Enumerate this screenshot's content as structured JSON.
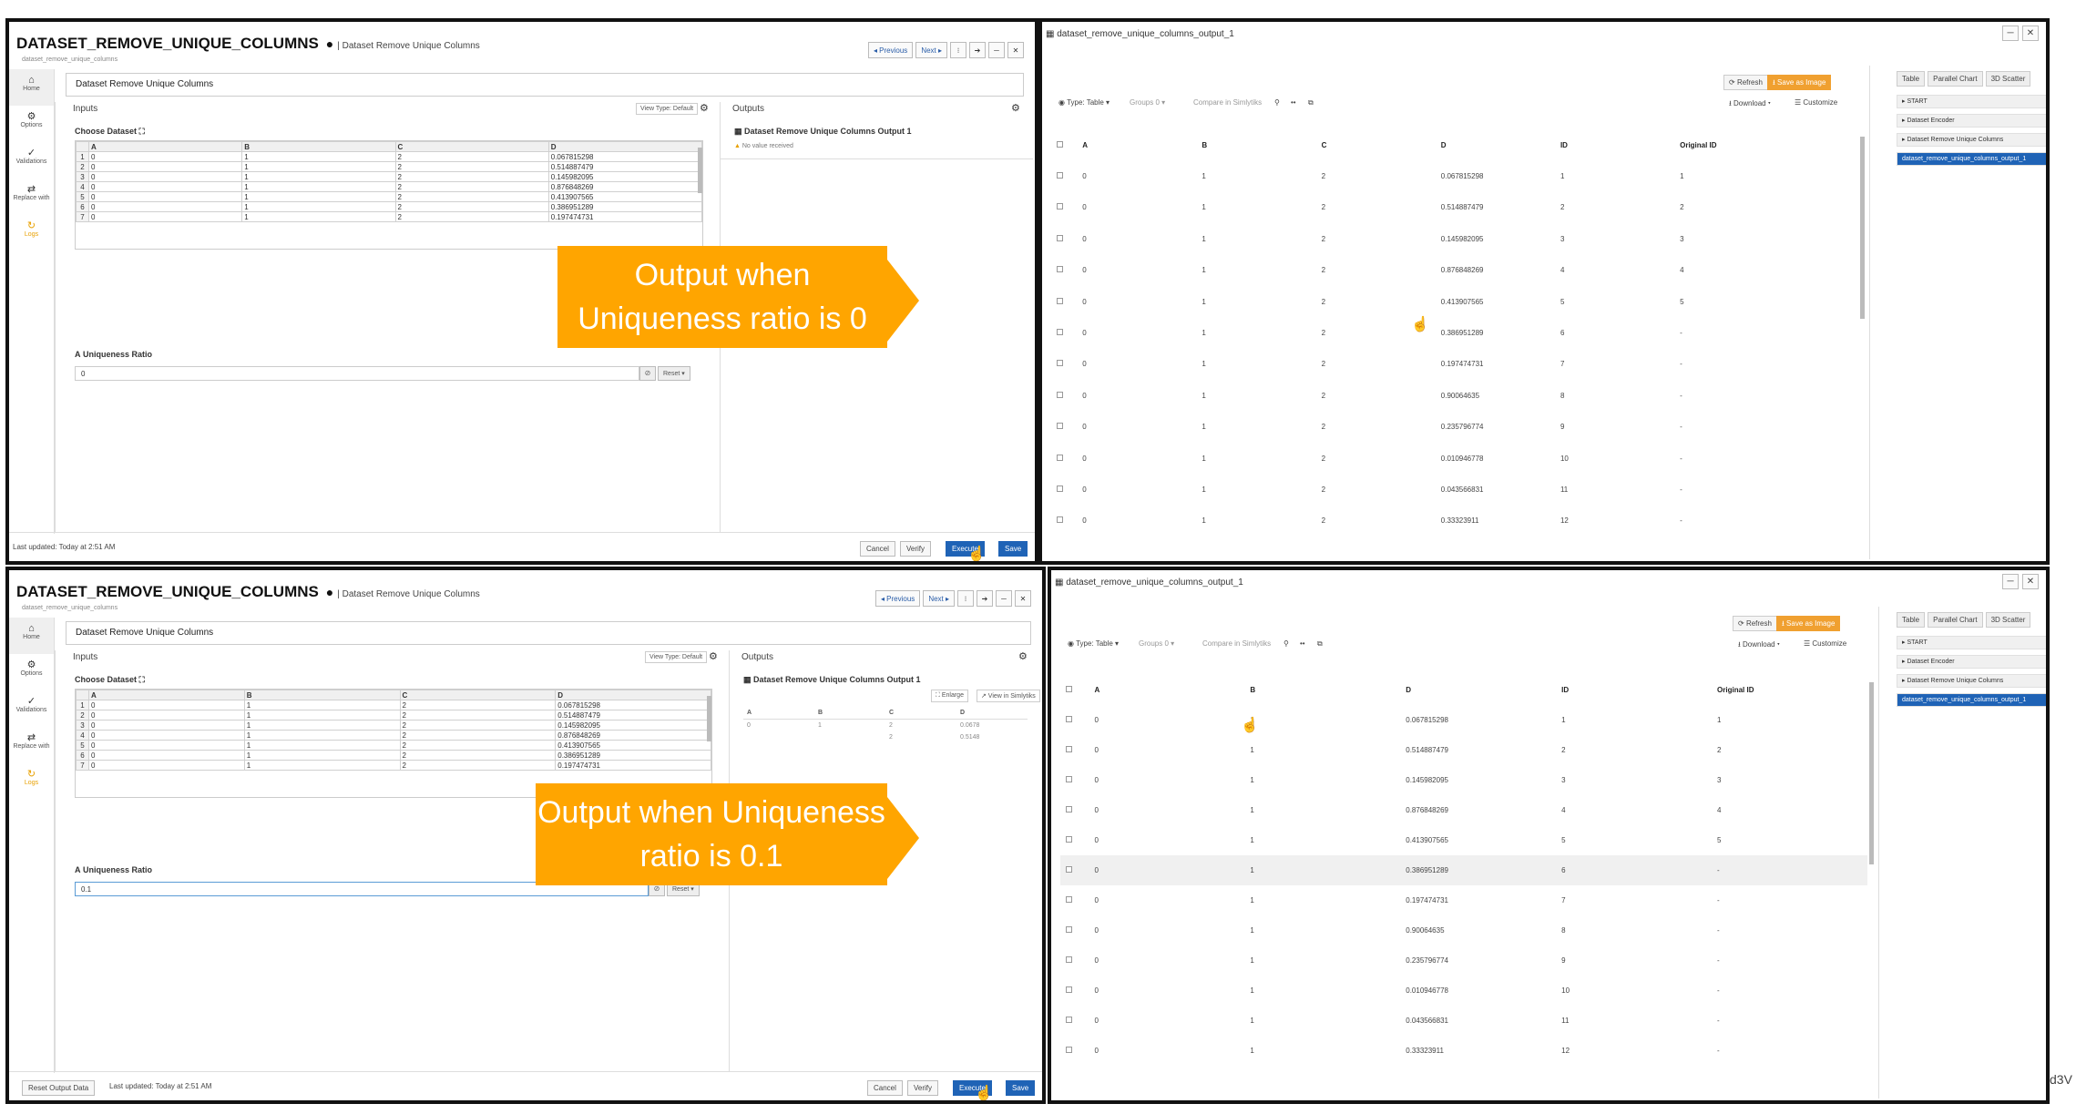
{
  "panels": {
    "top_left": {
      "title": "DATASET_REMOVE_UNIQUE_COLUMNS",
      "subtitle": "| Dataset Remove Unique Columns",
      "crumb": "dataset_remove_unique_columns",
      "nav": {
        "prev": "◂ Previous",
        "next": "Next ▸",
        "more": "⁝",
        "go": "➔",
        "min": "─",
        "close": "✕"
      },
      "sidebar": [
        {
          "icon": "⌂",
          "label": "Home"
        },
        {
          "icon": "⚙",
          "label": "Options"
        },
        {
          "icon": "✓",
          "label": "Validations"
        },
        {
          "icon": "⇄",
          "label": "Replace with"
        },
        {
          "icon": "↻",
          "label": "Logs"
        }
      ],
      "name_value": "Dataset Remove Unique Columns",
      "inputs_label": "Inputs",
      "view_type": "View Type: Default",
      "choose_dataset": "Choose Dataset ⛶",
      "grid": {
        "columns": [
          "A",
          "B",
          "C",
          "D"
        ],
        "rows": [
          [
            "1",
            "0",
            "1",
            "2",
            "0.067815298"
          ],
          [
            "2",
            "0",
            "1",
            "2",
            "0.514887479"
          ],
          [
            "3",
            "0",
            "1",
            "2",
            "0.145982095"
          ],
          [
            "4",
            "0",
            "1",
            "2",
            "0.876848269"
          ],
          [
            "5",
            "0",
            "1",
            "2",
            "0.413907565"
          ],
          [
            "6",
            "0",
            "1",
            "2",
            "0.386951289"
          ],
          [
            "7",
            "0",
            "1",
            "2",
            "0.197474731"
          ]
        ]
      },
      "uniqueness_label": "Uniqueness Ratio",
      "uniqueness_value": "0",
      "reset_label": "Reset ▾",
      "outputs_label": "Outputs",
      "output_name": "Dataset Remove Unique Columns Output 1",
      "no_value": "No value received",
      "footer": "Last updated: Today at 2:51 AM",
      "buttons": {
        "cancel": "Cancel",
        "verify": "Verify",
        "execute": "Execute",
        "save": "Save"
      }
    },
    "bottom_left": {
      "title": "DATASET_REMOVE_UNIQUE_COLUMNS",
      "subtitle": "| Dataset Remove Unique Columns",
      "crumb": "dataset_remove_unique_columns",
      "nav": {
        "prev": "◂ Previous",
        "next": "Next ▸",
        "more": "⁝",
        "go": "➔",
        "min": "─",
        "close": "✕"
      },
      "sidebar": [
        {
          "icon": "⌂",
          "label": "Home"
        },
        {
          "icon": "⚙",
          "label": "Options"
        },
        {
          "icon": "✓",
          "label": "Validations"
        },
        {
          "icon": "⇄",
          "label": "Replace with"
        },
        {
          "icon": "↻",
          "label": "Logs"
        }
      ],
      "name_value": "Dataset Remove Unique Columns",
      "inputs_label": "Inputs",
      "view_type": "View Type: Default",
      "choose_dataset": "Choose Dataset ⛶",
      "grid": {
        "columns": [
          "A",
          "B",
          "C",
          "D"
        ],
        "rows": [
          [
            "1",
            "0",
            "1",
            "2",
            "0.067815298"
          ],
          [
            "2",
            "0",
            "1",
            "2",
            "0.514887479"
          ],
          [
            "3",
            "0",
            "1",
            "2",
            "0.145982095"
          ],
          [
            "4",
            "0",
            "1",
            "2",
            "0.876848269"
          ],
          [
            "5",
            "0",
            "1",
            "2",
            "0.413907565"
          ],
          [
            "6",
            "0",
            "1",
            "2",
            "0.386951289"
          ],
          [
            "7",
            "0",
            "1",
            "2",
            "0.197474731"
          ]
        ]
      },
      "uniqueness_label": "Uniqueness Ratio",
      "uniqueness_value": "0.1",
      "reset_label": "Reset ▾",
      "outputs_label": "Outputs",
      "output_name": "Dataset Remove Unique Columns Output 1",
      "enlarge": "⛶ Enlarge",
      "view_simlytiks": "↗ View in Simlytiks",
      "mini": {
        "columns": [
          "A",
          "B",
          "C",
          "D"
        ],
        "row1": [
          "0",
          "1",
          "2",
          "0.0678"
        ],
        "row2": [
          "",
          "",
          "2",
          "0.5148"
        ]
      },
      "reset_output": "Reset Output Data",
      "footer": "Last updated: Today at 2:51 AM",
      "buttons": {
        "cancel": "Cancel",
        "verify": "Verify",
        "execute": "Execute",
        "save": "Save"
      }
    },
    "top_right": {
      "window_title": "dataset_remove_unique_columns_output_1",
      "refresh": "Refresh",
      "save_image": "Save as Image",
      "type_label": "Type: Table ▾",
      "groups_label": "Groups 0 ▾",
      "compare_label": "Compare in Simlytiks",
      "download": "Download ▾",
      "customize": "Customize",
      "tabs": [
        "Table",
        "Parallel Chart",
        "3D Scatter"
      ],
      "tree": [
        "▸ START",
        "▸ Dataset Encoder",
        "▸ Dataset Remove Unique Columns",
        "dataset_remove_unique_columns_output_1"
      ],
      "columns": [
        "A",
        "B",
        "C",
        "D",
        "ID",
        "Original ID"
      ],
      "rows": [
        [
          "0",
          "1",
          "2",
          "0.067815298",
          "1",
          "1"
        ],
        [
          "0",
          "1",
          "2",
          "0.514887479",
          "2",
          "2"
        ],
        [
          "0",
          "1",
          "2",
          "0.145982095",
          "3",
          "3"
        ],
        [
          "0",
          "1",
          "2",
          "0.876848269",
          "4",
          "4"
        ],
        [
          "0",
          "1",
          "2",
          "0.413907565",
          "5",
          "5"
        ],
        [
          "0",
          "1",
          "2",
          "0.386951289",
          "6",
          "-"
        ],
        [
          "0",
          "1",
          "2",
          "0.197474731",
          "7",
          "-"
        ],
        [
          "0",
          "1",
          "2",
          "0.90064635",
          "8",
          "-"
        ],
        [
          "0",
          "1",
          "2",
          "0.235796774",
          "9",
          "-"
        ],
        [
          "0",
          "1",
          "2",
          "0.010946778",
          "10",
          "-"
        ],
        [
          "0",
          "1",
          "2",
          "0.043566831",
          "11",
          "-"
        ],
        [
          "0",
          "1",
          "2",
          "0.33323911",
          "12",
          "-"
        ]
      ]
    },
    "bottom_right": {
      "window_title": "dataset_remove_unique_columns_output_1",
      "refresh": "Refresh",
      "save_image": "Save as Image",
      "type_label": "Type: Table ▾",
      "groups_label": "Groups 0 ▾",
      "compare_label": "Compare in Simlytiks",
      "download": "Download ▾",
      "customize": "Customize",
      "tabs": [
        "Table",
        "Parallel Chart",
        "3D Scatter"
      ],
      "tree": [
        "▸ START",
        "▸ Dataset Encoder",
        "▸ Dataset Remove Unique Columns",
        "dataset_remove_unique_columns_output_1"
      ],
      "columns": [
        "A",
        "B",
        "D",
        "ID",
        "Original ID"
      ],
      "rows": [
        [
          "0",
          "1",
          "0.067815298",
          "1",
          "1"
        ],
        [
          "0",
          "1",
          "0.514887479",
          "2",
          "2"
        ],
        [
          "0",
          "1",
          "0.145982095",
          "3",
          "3"
        ],
        [
          "0",
          "1",
          "0.876848269",
          "4",
          "4"
        ],
        [
          "0",
          "1",
          "0.413907565",
          "5",
          "5"
        ],
        [
          "0",
          "1",
          "0.386951289",
          "6",
          "-"
        ],
        [
          "0",
          "1",
          "0.197474731",
          "7",
          "-"
        ],
        [
          "0",
          "1",
          "0.90064635",
          "8",
          "-"
        ],
        [
          "0",
          "1",
          "0.235796774",
          "9",
          "-"
        ],
        [
          "0",
          "1",
          "0.010946778",
          "10",
          "-"
        ],
        [
          "0",
          "1",
          "0.043566831",
          "11",
          "-"
        ],
        [
          "0",
          "1",
          "0.33323911",
          "12",
          "-"
        ]
      ]
    }
  },
  "callouts": {
    "top": "Output when Uniqueness ratio is 0",
    "bottom": "Output when Uniqueness ratio is 0.1"
  },
  "edge_text": "d3V",
  "colors": {
    "accent": "#ffa500",
    "primary": "#1f63b6",
    "border": "#111111"
  }
}
